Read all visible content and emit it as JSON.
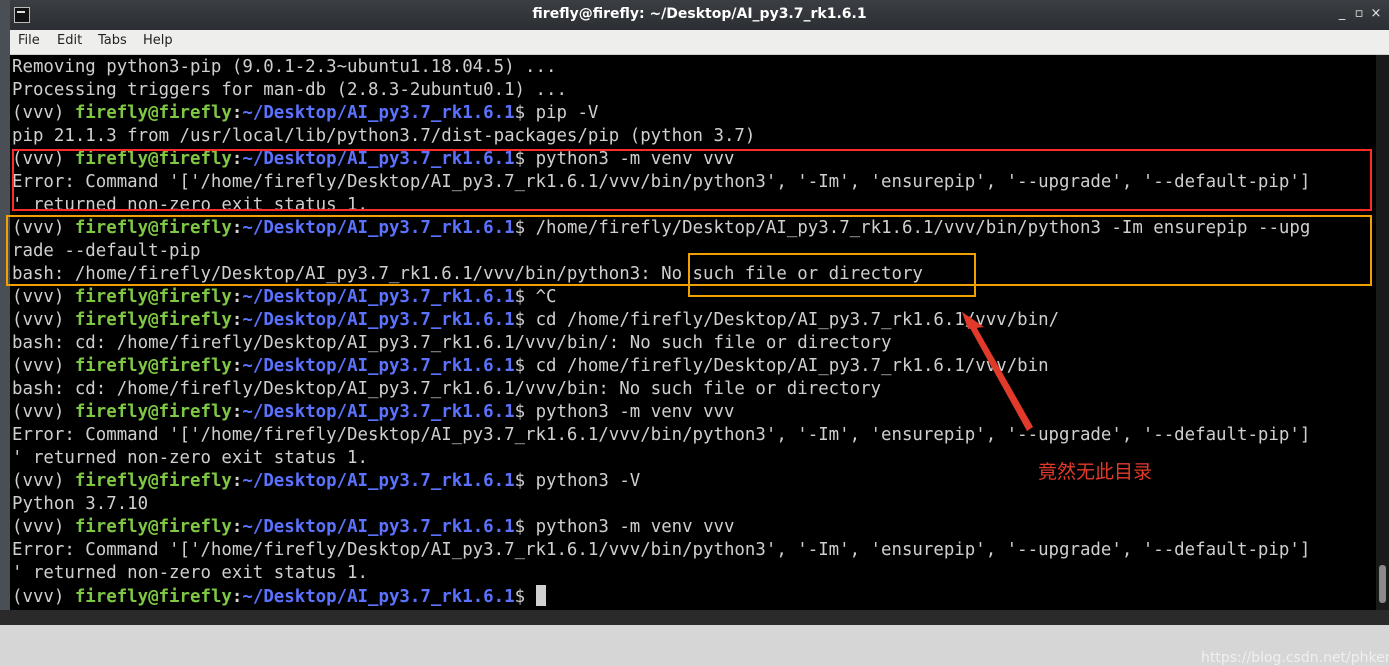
{
  "window": {
    "title": "firefly@firefly: ~/Desktop/AI_py3.7_rk1.6.1",
    "menu": [
      "File",
      "Edit",
      "Tabs",
      "Help"
    ],
    "controls": {
      "minimize": "_",
      "maximize": "▫",
      "close": "×"
    }
  },
  "terminal": {
    "lines": [
      "Removing python3-pip (9.0.1-2.3~ubuntu1.18.04.5) ...",
      "Processing triggers for man-db (2.8.3-2ubuntu0.1) ...",
      "pip 21.1.3 from /usr/local/lib/python3.7/dist-packages/pip (python 3.7)",
      "Error: Command '['/home/firefly/Desktop/AI_py3.7_rk1.6.1/vvv/bin/python3', '-Im', 'ensurepip', '--upgrade', '--default-pip']",
      "' returned non-zero exit status 1.",
      "rade --default-pip",
      "bash: /home/firefly/Desktop/AI_py3.7_rk1.6.1/vvv/bin/python3: No such file or directory",
      "bash: cd: /home/firefly/Desktop/AI_py3.7_rk1.6.1/vvv/bin/: No such file or directory",
      "bash: cd: /home/firefly/Desktop/AI_py3.7_rk1.6.1/vvv/bin: No such file or directory",
      "Error: Command '['/home/firefly/Desktop/AI_py3.7_rk1.6.1/vvv/bin/python3', '-Im', 'ensurepip', '--upgrade', '--default-pip']",
      "' returned non-zero exit status 1.",
      "Python 3.7.10",
      "Error: Command '['/home/firefly/Desktop/AI_py3.7_rk1.6.1/vvv/bin/python3', '-Im', 'ensurepip', '--upgrade', '--default-pip']",
      "' returned non-zero exit status 1."
    ],
    "prompt": {
      "env": "(vvv) ",
      "user_host": "firefly@firefly",
      "colon": ":",
      "path": "~/Desktop/AI_py3.7_rk1.6.1",
      "dollar": "$ "
    },
    "commands": [
      "pip -V",
      "python3 -m venv vvv",
      "/home/firefly/Desktop/AI_py3.7_rk1.6.1/vvv/bin/python3 -Im ensurepip --upg",
      "^C",
      "cd /home/firefly/Desktop/AI_py3.7_rk1.6.1/vvv/bin/",
      "cd /home/firefly/Desktop/AI_py3.7_rk1.6.1/vvv/bin",
      "python3 -m venv vvv",
      "python3 -V",
      "python3 -m venv vvv",
      ""
    ]
  },
  "annotation": {
    "text": "竟然无此目录"
  },
  "watermark": "https://blog.csdn.net/phker",
  "colors": {
    "terminal_bg": "#000000",
    "terminal_fg": "#cfcfcf",
    "prompt_user": "#7ec843",
    "prompt_path": "#5b72ff",
    "highlight_red": "#ff2a2a",
    "highlight_orange": "#f0a000",
    "annotation": "#e23a2a"
  },
  "icons": [
    "terminal-app-icon",
    "minimize-icon",
    "maximize-icon",
    "close-icon",
    "arrow-annotation-icon"
  ]
}
